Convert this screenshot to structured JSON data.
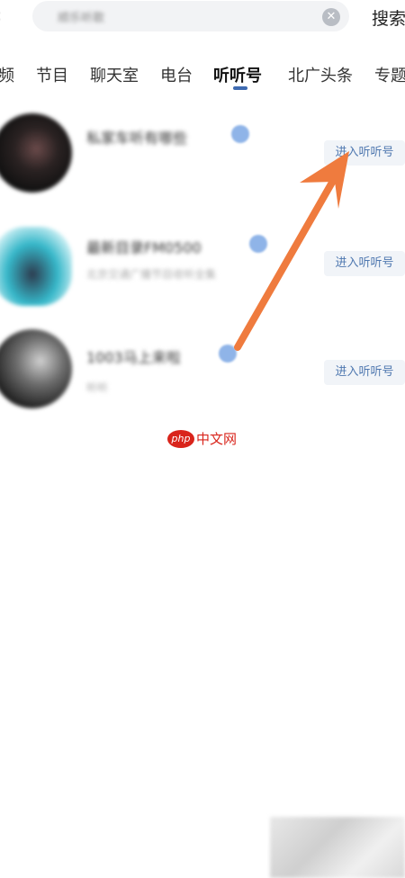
{
  "search": {
    "query": "顺乐听歌",
    "search_label": "搜索"
  },
  "tabs": [
    {
      "label": "频"
    },
    {
      "label": "节目"
    },
    {
      "label": "聊天室"
    },
    {
      "label": "电台"
    },
    {
      "label": "听听号"
    },
    {
      "label": "北广头条"
    },
    {
      "label": "专题"
    }
  ],
  "active_tab": "听听号",
  "results": [
    {
      "name": "私家车听有哪些",
      "subtitle": "",
      "button": "进入听听号"
    },
    {
      "name": "最新目录FM0500",
      "subtitle": "北京交通广播节目收听全集",
      "button": "进入听听号"
    },
    {
      "name": "1003马上来啦",
      "subtitle": "听听",
      "button": "进入听听号"
    }
  ],
  "watermark": {
    "logo": "php",
    "text": "中文网"
  },
  "colors": {
    "accent": "#3f6bb1",
    "annotation_arrow": "#ef7b3e",
    "watermark": "#d9241b"
  }
}
